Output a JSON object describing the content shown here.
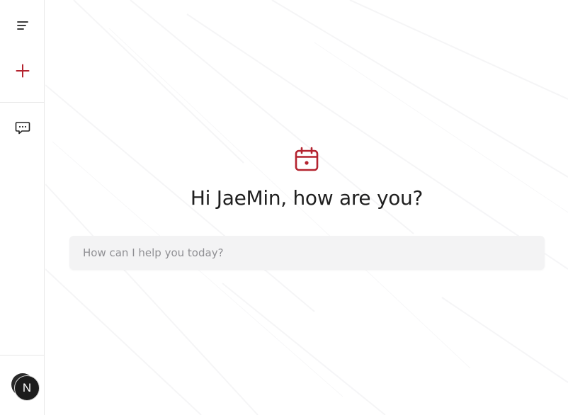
{
  "sidebar": {
    "menu_icon": "menu-icon",
    "new_icon": "plus-icon",
    "chat_icon": "chat-bubble-icon",
    "avatar_initial": "N"
  },
  "main": {
    "hero_icon": "calendar-icon",
    "greeting": "Hi JaeMin, how are you?",
    "prompt_placeholder": "How can I help you today?"
  },
  "colors": {
    "accent": "#b4232f",
    "text": "#1f1f1f",
    "input_bg": "#f3f3f4",
    "placeholder": "#8f8f93",
    "avatar_bg": "#1c1c1c"
  }
}
